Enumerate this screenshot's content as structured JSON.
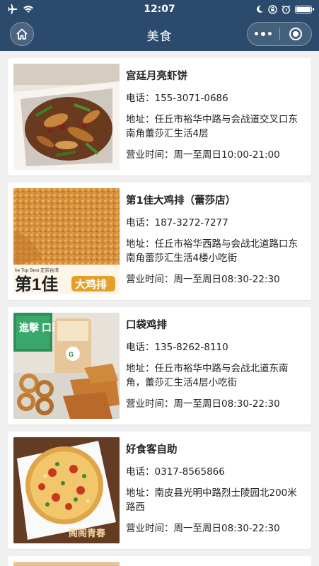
{
  "status_bar": {
    "time": "12:07"
  },
  "nav": {
    "title": "美食"
  },
  "restaurants": [
    {
      "name": "宫廷月亮虾饼",
      "phone_label": "电话：",
      "phone": "155-3071-0686",
      "addr_label": "地址：",
      "address": "任丘市裕华中路与会战道交叉口东南角蕾莎汇生活4层",
      "hours_label": "营业时间：",
      "hours": "周一至周日10:00-21:00"
    },
    {
      "name": "第1佳大鸡排（蕾莎店）",
      "phone_label": "电话：",
      "phone": "187-3272-7277",
      "addr_label": "地址：",
      "address": "任丘市裕华西路与会战北道路口东南角蕾莎汇生活4楼小吃街",
      "hours_label": "营业时间：",
      "hours": "周一至周日08:30-22:30",
      "logo_text": "第1佳",
      "logo_sub": "大鸡排",
      "logo_small": "he Top Best 正宗台湾"
    },
    {
      "name": "口袋鸡排",
      "phone_label": "电话：",
      "phone": "135-8262-8110",
      "addr_label": "地址：",
      "address": "任丘市裕华中路与会战北道东南角，蕾莎汇生活4层小吃街",
      "hours_label": "营业时间：",
      "hours": "周一至周日08:30-22:30",
      "sign_text": "進擊 口家"
    },
    {
      "name": "好食客自助",
      "phone_label": "电话：",
      "phone": "0317-8565866",
      "addr_label": "地址：",
      "address": "南皮县光明中路烈士陵园北200米路西",
      "hours_label": "营业时间：",
      "hours": "周一至周日08:30-22:30",
      "watermark": "阁阁青春"
    }
  ],
  "colors": {
    "header_bg": "#2c4a6b",
    "page_bg": "#f0f0f0",
    "card_bg": "#ffffff"
  }
}
